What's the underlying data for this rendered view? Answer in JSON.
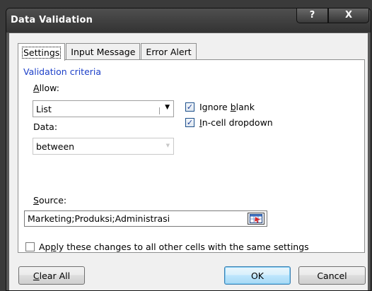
{
  "dialog": {
    "title": "Data Validation",
    "help_glyph": "?",
    "close_glyph": "X"
  },
  "tabs": [
    {
      "label": "Settings",
      "active": true
    },
    {
      "label": "Input Message",
      "active": false
    },
    {
      "label": "Error Alert",
      "active": false
    }
  ],
  "settings": {
    "section_title": "Validation criteria",
    "allow": {
      "label_mnemonic": "A",
      "label_rest": "llow:",
      "value": "List"
    },
    "data": {
      "label": "Data:",
      "value": "between"
    },
    "ignore_blank": {
      "label_pre": "Ignore ",
      "label_mnemonic": "b",
      "label_post": "lank",
      "checked": true
    },
    "in_cell_dropdown": {
      "label_mnemonic": "I",
      "label_post": "n-cell dropdown",
      "checked": true
    },
    "source": {
      "label_mnemonic": "S",
      "label_rest": "ource:",
      "value": "Marketing;Produksi;Administrasi"
    },
    "apply_all": {
      "label_pre": "Ap",
      "label_mnemonic": "p",
      "label_post": "ly these changes to all other cells with the same settings",
      "checked": false
    }
  },
  "buttons": {
    "clear_all_mnemonic": "C",
    "clear_all_rest": "lear All",
    "ok": "OK",
    "cancel": "Cancel"
  },
  "colors": {
    "section_title": "#1c3fc8",
    "checkbox_check": "#1a3c94",
    "titlebar": "#3f3f3f"
  }
}
